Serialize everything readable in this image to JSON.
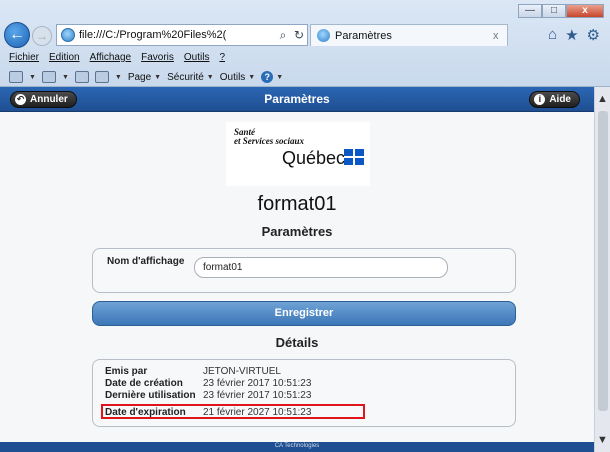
{
  "window": {
    "minimize": "—",
    "maximize": "□",
    "close": "x"
  },
  "nav": {
    "back": "←",
    "forward": "→",
    "address": "file:///C:/Program%20Files%2(",
    "search_glyph": "⌕",
    "refresh_glyph": "↻",
    "tab_title": "Paramètres",
    "tab_close": "x",
    "home_icon": "⌂",
    "star_icon": "★",
    "gear_icon": "⚙"
  },
  "menu": [
    "Fichier",
    "Edition",
    "Affichage",
    "Favoris",
    "Outils",
    "?"
  ],
  "commands": {
    "page": "Page",
    "security": "Sécurité",
    "tools": "Outils"
  },
  "header": {
    "cancel": "Annuler",
    "title": "Paramètres",
    "help": "Aide"
  },
  "logo": {
    "line1": "Santé",
    "line2": "et Services sociaux",
    "quebec": "Québec"
  },
  "certificate_name": "format01",
  "params_title": "Paramètres",
  "name_field": {
    "label": "Nom d'affichage",
    "value": "format01"
  },
  "save_label": "Enregistrer",
  "details_title": "Détails",
  "details": [
    {
      "key": "Emis par",
      "value": "JETON-VIRTUEL"
    },
    {
      "key": "Date de création",
      "value": "23 février 2017 10:51:23"
    },
    {
      "key": "Dernière utilisation",
      "value": "23 février 2017 10:51:23"
    },
    {
      "key": "Date d'expiration",
      "value": "21 février 2027 10:51:23"
    }
  ],
  "footer": "CA Technologies",
  "colors": {
    "header_blue": "#2b66b3",
    "button_blue": "#4f8bc7",
    "highlight_red": "#e0141b"
  }
}
